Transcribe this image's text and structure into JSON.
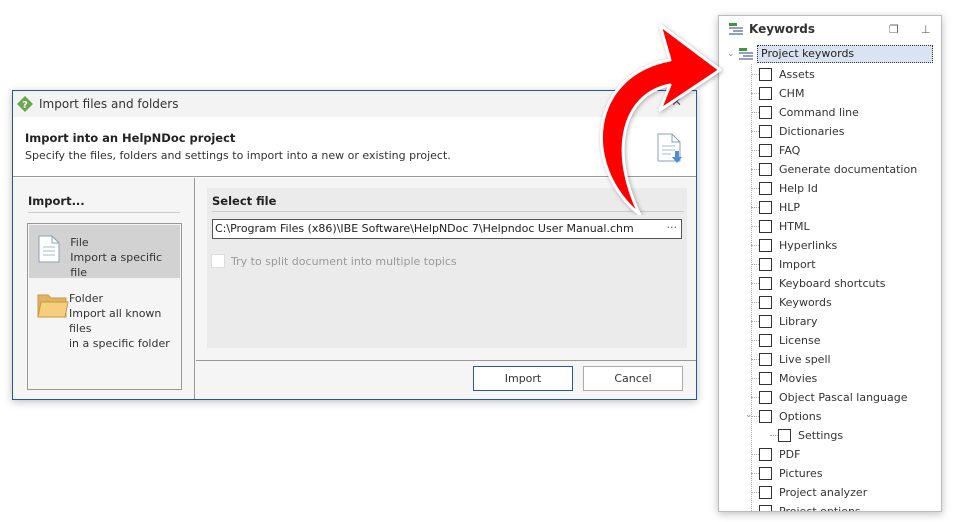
{
  "dialog": {
    "title": "Import files and folders",
    "header_title": "Import into an HelpNDoc project",
    "header_subtitle": "Specify the files, folders and settings to import into a new or existing project.",
    "left_section": "Import...",
    "options": [
      {
        "title": "File",
        "desc1": "Import a specific file",
        "desc2": "",
        "selected": true
      },
      {
        "title": "Folder",
        "desc1": "Import all known files",
        "desc2": "in a specific folder",
        "selected": false
      }
    ],
    "select_section": "Select file",
    "file_path": "C:\\Program Files (x86)\\IBE Software\\HelpNDoc 7\\Helpndoc User Manual.chm",
    "browse_label": "···",
    "split_label": "Try to split document into multiple topics",
    "split_checked": false,
    "import_button": "Import",
    "cancel_button": "Cancel"
  },
  "keywords": {
    "title": "Keywords",
    "root": "Project keywords",
    "items": [
      {
        "label": "Assets"
      },
      {
        "label": "CHM"
      },
      {
        "label": "Command line"
      },
      {
        "label": "Dictionaries"
      },
      {
        "label": "FAQ"
      },
      {
        "label": "Generate documentation"
      },
      {
        "label": "Help Id"
      },
      {
        "label": "HLP"
      },
      {
        "label": "HTML"
      },
      {
        "label": "Hyperlinks"
      },
      {
        "label": "Import"
      },
      {
        "label": "Keyboard shortcuts"
      },
      {
        "label": "Keywords"
      },
      {
        "label": "Library"
      },
      {
        "label": "License"
      },
      {
        "label": "Live spell"
      },
      {
        "label": "Movies"
      },
      {
        "label": "Object Pascal language"
      },
      {
        "label": "Options",
        "expanded": true
      },
      {
        "label": "Settings",
        "child": true
      },
      {
        "label": "PDF"
      },
      {
        "label": "Pictures"
      },
      {
        "label": "Project analyzer"
      },
      {
        "label": "Project options"
      }
    ]
  },
  "colors": {
    "accent": "#2b579a",
    "arrow": "#ff0000",
    "selection": "#d9e3f2"
  }
}
